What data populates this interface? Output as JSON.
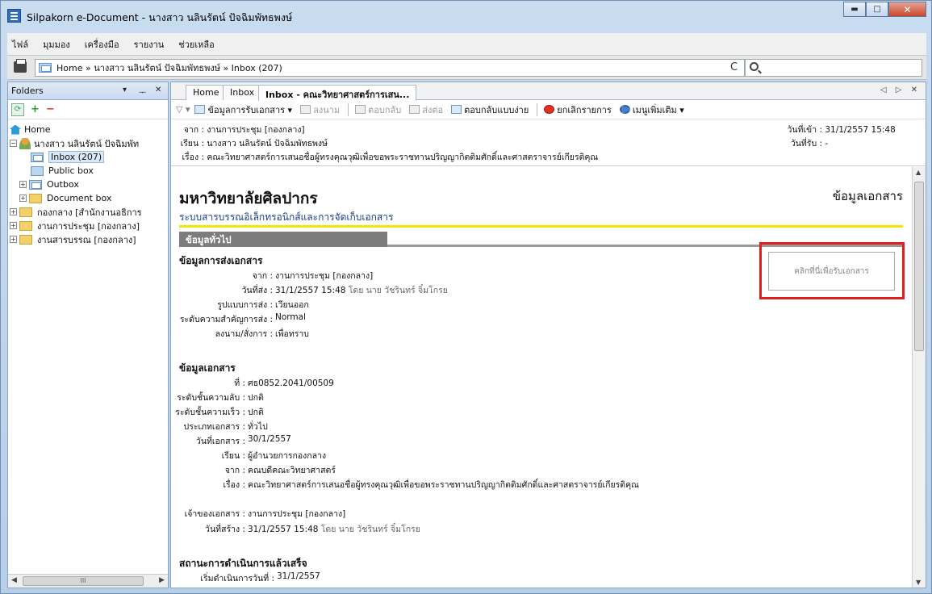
{
  "window": {
    "title": "Silpakorn e-Document - นางสาว นลินรัตน์ ปัจฉิมพัทธพงษ์",
    "min": "▬",
    "max": "□",
    "close": "✕"
  },
  "menu": [
    "ไฟล์",
    "มุมมอง",
    "เครื่องมือ",
    "รายงาน",
    "ช่วยเหลือ"
  ],
  "address": {
    "path": "Home » นางสาว นลินรัตน์ ปัจฉิมพัทธพงษ์ » Inbox (207)",
    "refresh": "C"
  },
  "folders": {
    "header": "Folders",
    "ctl_dropdown": "▾",
    "ctl_pin": "ᅮ",
    "ctl_close": "✕",
    "tree": [
      {
        "label": "Home"
      },
      {
        "label": "นางสาว นลินรัตน์ ปัจฉิมพัท"
      },
      {
        "label": "Inbox (207)"
      },
      {
        "label": "Public box"
      },
      {
        "label": "Outbox"
      },
      {
        "label": "Document box"
      },
      {
        "label": "กองกลาง [สำนักงานอธิการ"
      },
      {
        "label": "งานการประชุม [กองกลาง]"
      },
      {
        "label": "งานสารบรรณ [กองกลาง]"
      }
    ],
    "scroll_thumb": "III"
  },
  "tabs": [
    {
      "label": "Home"
    },
    {
      "label": "Inbox"
    },
    {
      "label": "Inbox - คณะวิทยาศาสตร์การเสน..."
    }
  ],
  "tab_controls": "◁ ▷ ✕",
  "toolbar": {
    "receive": "ข้อมูลการรับเอกสาร ▾",
    "sign": "ลงนาม",
    "reply": "ตอบกลับ",
    "forward": "ส่งต่อ",
    "quick_reply": "ตอบกลับแบบง่าย",
    "cancel": "ยกเลิกรายการ",
    "more": "เมนูเพิ่มเติม ▾"
  },
  "header_info": {
    "from_k": "จาก :",
    "from_v": "งานการประชุม [กองกลาง]",
    "to_k": "เรียน :",
    "to_v": "นางสาว นลินรัตน์ ปัจฉิมพัทธพงษ์",
    "subject_k": "เรื่อง :",
    "subject_v": "คณะวิทยาศาสตร์การเสนอชื่อผู้ทรงคุณวุฒิเพื่อขอพระราชทานปริญญากิตติมศักดิ์และศาสตราจารย์เกียรติคุณ",
    "in_date_k": "วันที่เข้า :",
    "in_date_v": "31/1/2557 15:48",
    "recv_date_k": "วันที่รับ :",
    "recv_date_v": "-"
  },
  "content": {
    "university": "มหาวิทยาลัยศิลปากร",
    "doc_info": "ข้อมูลเอกสาร",
    "system": "ระบบสารบรรณอิเล็กทรอนิกส์และการจัดเก็บเอกสาร",
    "general_tab": "ข้อมูลทั่วไป",
    "receive_button": "คลิกที่นี่เพื่อรับเอกสาร",
    "send_section": {
      "title": "ข้อมูลการส่งเอกสาร",
      "from_k": "จาก :",
      "from_v": "งานการประชุม [กองกลาง]",
      "sent_k": "วันที่ส่ง :",
      "sent_v": "31/1/2557 15:48",
      "sent_by": "โดย นาย วัชรินทร์ จิ๋มโกรย",
      "format_k": "รูปแบบการส่ง :",
      "format_v": "เวียนออก",
      "priority_k": "ระดับความสำคัญการส่ง :",
      "priority_v": "Normal",
      "order_k": "ลงนาม/สั่งการ :",
      "order_v": "เพื่อทราบ"
    },
    "doc_section": {
      "title": "ข้อมูลเอกสาร",
      "no_k": "ที่ :",
      "no_v": "ศธ0852.2041/00509",
      "secret_k": "ระดับชั้นความลับ :",
      "secret_v": "ปกติ",
      "speed_k": "ระดับชั้นความเร็ว :",
      "speed_v": "ปกติ",
      "type_k": "ประเภทเอกสาร :",
      "type_v": "ทั่วไป",
      "date_k": "วันที่เอกสาร :",
      "date_v": "30/1/2557",
      "to_k": "เรียน :",
      "to_v": "ผู้อำนวยการกองกลาง",
      "from_k": "จาก :",
      "from_v": "คณบดีคณะวิทยาศาสตร์",
      "subject_k": "เรื่อง :",
      "subject_v": "คณะวิทยาศาสตร์การเสนอชื่อผู้ทรงคุณวุฒิเพื่อขอพระราชทานปริญญากิตติมศักดิ์และศาสตราจารย์เกียรติคุณ",
      "owner_k": "เจ้าของเอกสาร :",
      "owner_v": "งานการประชุม [กองกลาง]",
      "created_k": "วันที่สร้าง :",
      "created_v": "31/1/2557 15:48",
      "created_by": "โดย นาย วัชรินทร์ จิ๋มโกรย"
    },
    "status_section": {
      "title": "สถานะการดำเนินการแล้วเสร็จ",
      "start_k": "เริ่มดำเนินการวันที่ :",
      "start_v": "31/1/2557"
    }
  },
  "colors": {
    "highlight_box": "#e01f1f",
    "accent_line": "#f5e400",
    "link_blue": "#1b3f8a"
  }
}
